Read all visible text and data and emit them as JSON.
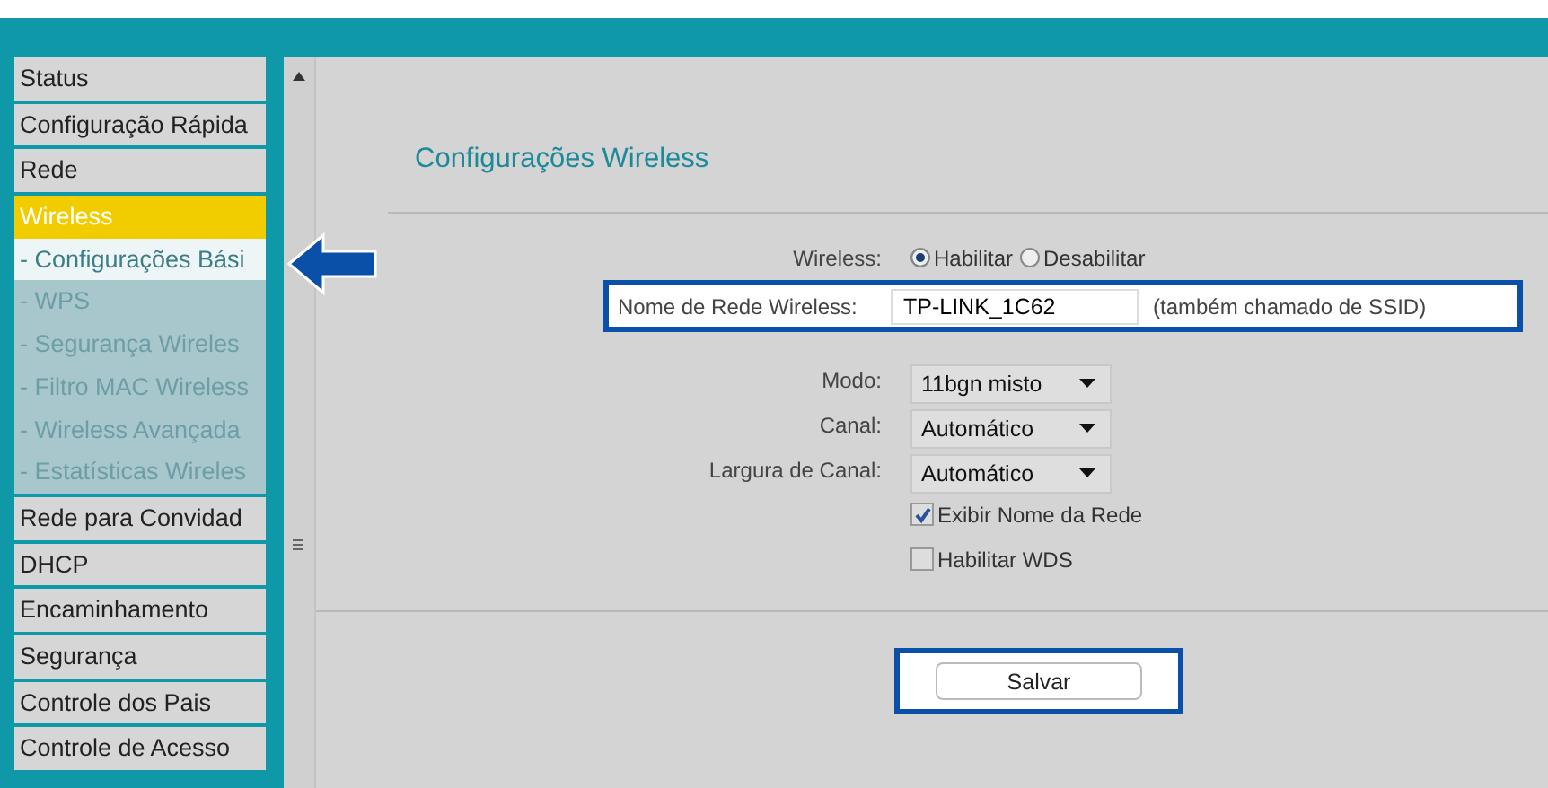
{
  "sidebar": {
    "items": [
      {
        "label": "Status",
        "kind": "main",
        "selected": false
      },
      {
        "label": "Configuração Rápida",
        "kind": "main",
        "selected": false
      },
      {
        "label": "Rede",
        "kind": "main",
        "selected": false
      },
      {
        "label": "Wireless",
        "kind": "main",
        "selected": true
      },
      {
        "label": "- Configurações Bási",
        "kind": "sub",
        "selected": true
      },
      {
        "label": "- WPS",
        "kind": "sub",
        "selected": false
      },
      {
        "label": "- Segurança Wireles",
        "kind": "sub",
        "selected": false
      },
      {
        "label": "- Filtro MAC Wireless",
        "kind": "sub",
        "selected": false
      },
      {
        "label": "- Wireless Avançada",
        "kind": "sub",
        "selected": false
      },
      {
        "label": "- Estatísticas Wireles",
        "kind": "sub",
        "selected": false
      },
      {
        "label": "Rede para Convidad",
        "kind": "main",
        "selected": false
      },
      {
        "label": "DHCP",
        "kind": "main",
        "selected": false
      },
      {
        "label": "Encaminhamento",
        "kind": "main",
        "selected": false
      },
      {
        "label": "Segurança",
        "kind": "main",
        "selected": false
      },
      {
        "label": "Controle dos Pais",
        "kind": "main",
        "selected": false
      },
      {
        "label": "Controle de Acesso",
        "kind": "main",
        "selected": false
      }
    ]
  },
  "content": {
    "title": "Configurações Wireless",
    "wireless": {
      "label": "Wireless:",
      "options": [
        {
          "label": "Habilitar",
          "selected": true
        },
        {
          "label": "Desabilitar",
          "selected": false
        }
      ]
    },
    "ssid": {
      "label": "Nome de Rede Wireless:",
      "value": "TP-LINK_1C62",
      "hint": "(também chamado de SSID)",
      "highlighted": true
    },
    "selects": [
      {
        "label": "Modo:",
        "value": "11bgn misto"
      },
      {
        "label": "Canal:",
        "value": "Automático"
      },
      {
        "label": "Largura de Canal:",
        "value": "Automático"
      }
    ],
    "checkboxes": [
      {
        "label": "Exibir Nome da Rede",
        "checked": true
      },
      {
        "label": "Habilitar WDS",
        "checked": false
      }
    ],
    "save": {
      "label": "Salvar",
      "highlighted": true
    }
  }
}
